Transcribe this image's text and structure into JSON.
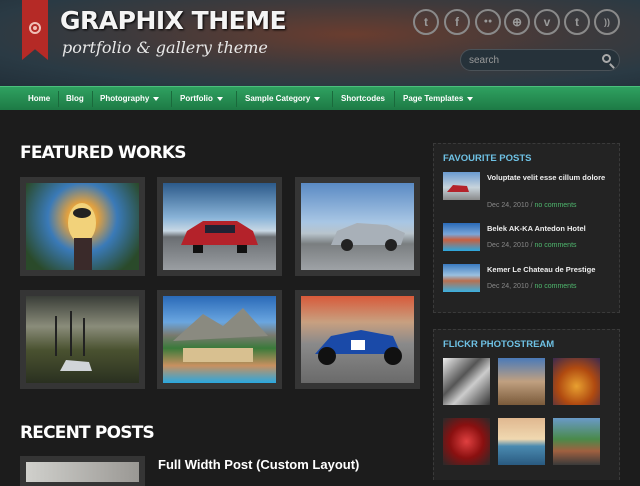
{
  "header": {
    "logo_title": "GRAPHIX THEME",
    "tagline": "portfolio & gallery theme",
    "social_icons": [
      "twitter-icon",
      "facebook-icon",
      "flickr-icon",
      "dribbble-icon",
      "vimeo-icon",
      "tumblr-icon",
      "rss-icon"
    ],
    "social_glyphs": [
      "t",
      "f",
      "●●",
      "⊕",
      "v",
      "t",
      "))"
    ],
    "search_placeholder": "search"
  },
  "nav": {
    "items": [
      {
        "label": "Home"
      },
      {
        "label": "Blog"
      },
      {
        "label": "Photography"
      },
      {
        "label": "Portfolio"
      },
      {
        "label": "Sample Category"
      },
      {
        "label": "Shortcodes"
      },
      {
        "label": "Page Templates"
      }
    ]
  },
  "main": {
    "featured_title": "FEATURED WORKS",
    "recent_title": "RECENT POSTS",
    "recent_post_title": "Full Width Post (Custom Layout)"
  },
  "sidebar": {
    "favourite_title": "FAVOURITE POSTS",
    "favourites": [
      {
        "title": "Voluptate velit esse cillum dolore",
        "date": "Dec 24, 2010",
        "comments": "no comments"
      },
      {
        "title": "Belek AK-KA Antedon Hotel",
        "date": "Dec 24, 2010",
        "comments": "no comments"
      },
      {
        "title": "Kemer Le Chateau de Prestige",
        "date": "Dec 24, 2010",
        "comments": "no comments"
      }
    ],
    "date_sep": " / ",
    "flickr_title": "FLICKR PHOTOSTREAM"
  },
  "colors": {
    "accent_green": "#2fa160",
    "link_blue": "#6ec1e4",
    "ribbon_red": "#b52a26"
  }
}
